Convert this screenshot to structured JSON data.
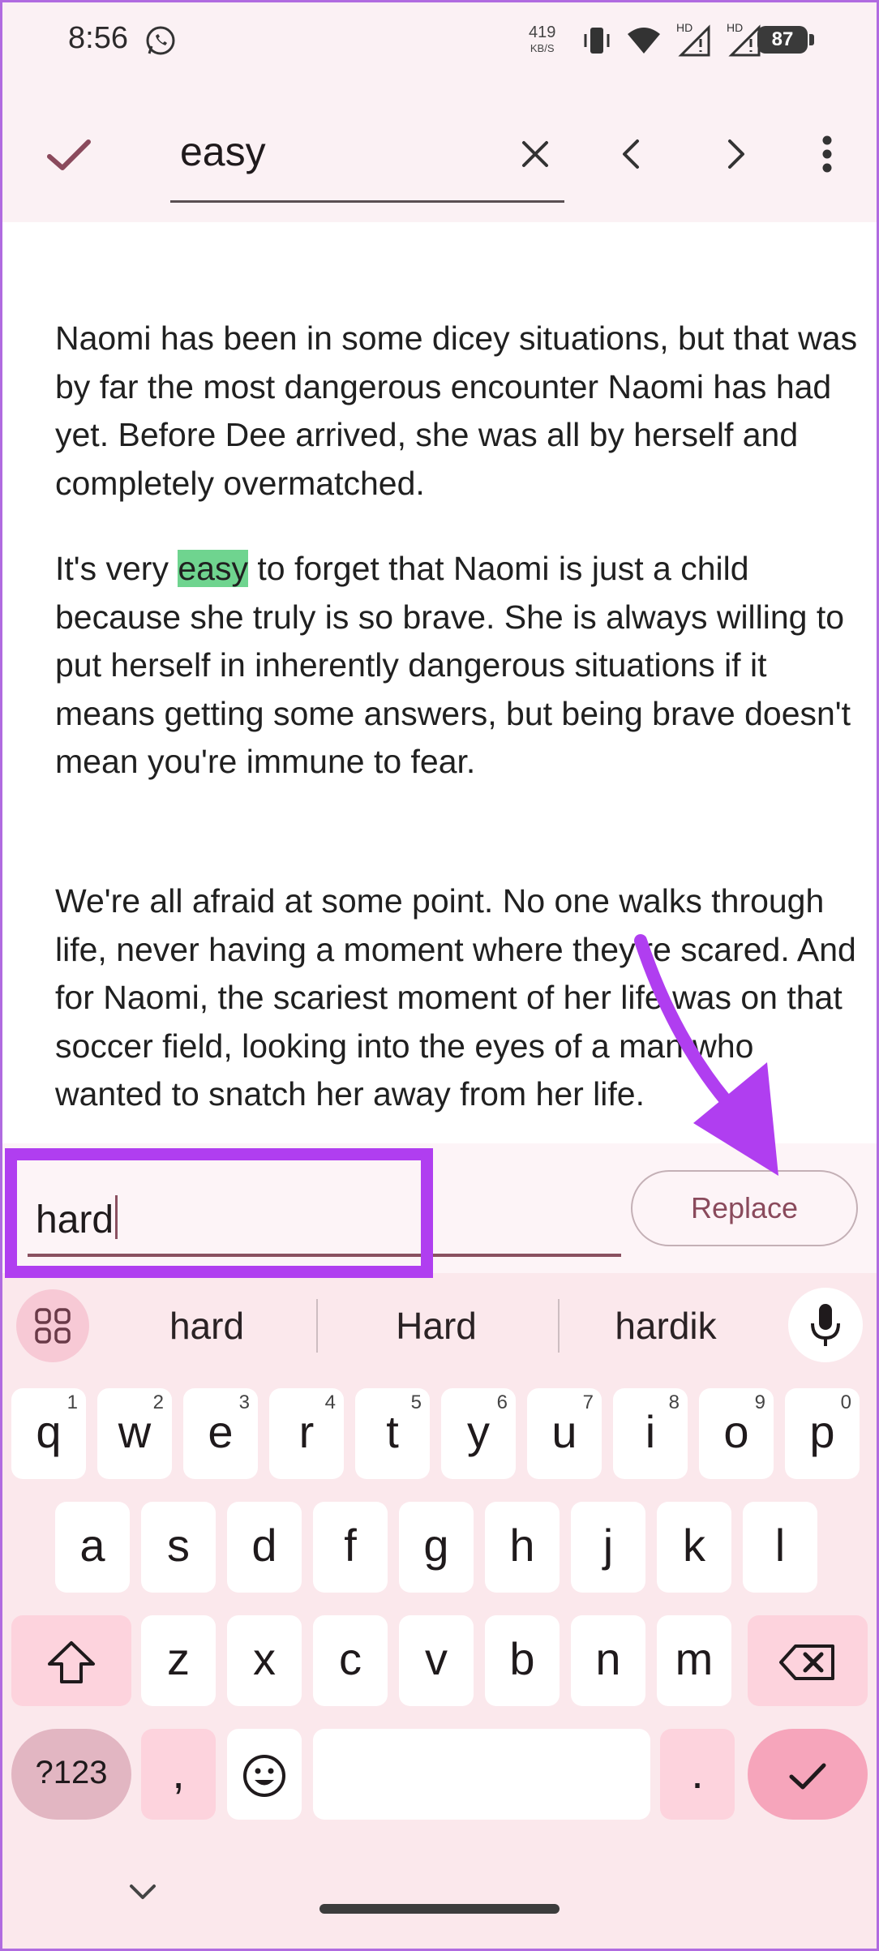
{
  "status_bar": {
    "time": "8:56",
    "net_speed_value": "419",
    "net_speed_unit": "KB/S",
    "battery": "87",
    "signal_label_1": "HD",
    "signal_label_2": "HD"
  },
  "find_bar": {
    "query": "easy"
  },
  "document": {
    "p1": "Naomi has been in some dicey situations, but that was by far the most dangerous encounter Naomi has had yet. Before Dee arrived, she was all by herself and completely overmatched.",
    "p2_before": "It's very ",
    "p2_match": "easy",
    "p2_after": " to forget that Naomi is just a child because she truly is so brave. She is always willing to put herself in inherently dangerous situations if it means getting some answers, but being brave doesn't mean you're immune to fear.",
    "p3": "We're all afraid at some point. No one walks through life, never having a moment where they're scared. And for Naomi, the scariest moment of her life was on that soccer field, looking into the eyes of a man who wanted to snatch her away from her life."
  },
  "replace_row": {
    "value": "hard",
    "button_label": "Replace"
  },
  "keyboard": {
    "suggestions": [
      "hard",
      "Hard",
      "hardik"
    ],
    "row1": [
      {
        "k": "q",
        "h": "1"
      },
      {
        "k": "w",
        "h": "2"
      },
      {
        "k": "e",
        "h": "3"
      },
      {
        "k": "r",
        "h": "4"
      },
      {
        "k": "t",
        "h": "5"
      },
      {
        "k": "y",
        "h": "6"
      },
      {
        "k": "u",
        "h": "7"
      },
      {
        "k": "i",
        "h": "8"
      },
      {
        "k": "o",
        "h": "9"
      },
      {
        "k": "p",
        "h": "0"
      }
    ],
    "row2": [
      "a",
      "s",
      "d",
      "f",
      "g",
      "h",
      "j",
      "k",
      "l"
    ],
    "row3": [
      "z",
      "x",
      "c",
      "v",
      "b",
      "n",
      "m"
    ],
    "sym_label": "?123",
    "comma": ",",
    "period": "."
  },
  "colors": {
    "accent": "#b03ef0",
    "highlight": "#6fd48f",
    "toolbar_bg": "#fbf1f4"
  }
}
